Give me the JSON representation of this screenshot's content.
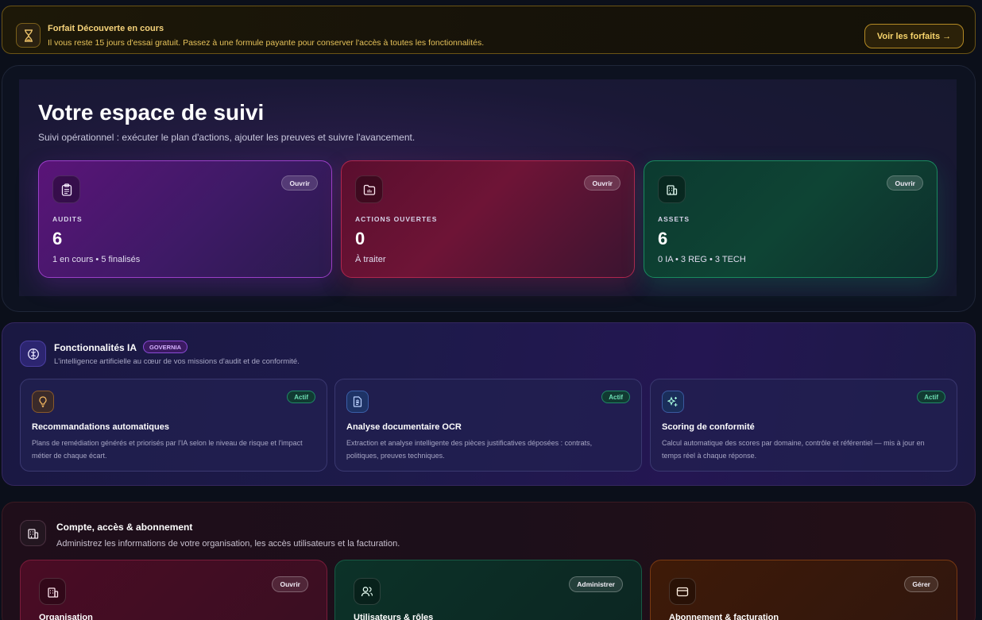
{
  "banner": {
    "title": "Forfait Découverte en cours",
    "message": "Il vous reste 15 jours d'essai gratuit. Passez à une formule payante pour conserver l'accès à toutes les fonctionnalités.",
    "cta": "Voir les forfaits →",
    "icon": "hourglass-icon"
  },
  "hero": {
    "title": "Votre espace de suivi",
    "subtitle": "Suivi opérationnel : exécuter le plan d'actions, ajouter les preuves et suivre l'avancement.",
    "kpis": [
      {
        "label": "AUDITS",
        "value": "6",
        "sub": "1 en cours • 5 finalisés",
        "action": "Ouvrir",
        "icon": "clipboard-icon",
        "color": "#9b3fc8"
      },
      {
        "label": "ACTIONS OUVERTES",
        "value": "0",
        "sub": "À traiter",
        "action": "Ouvrir",
        "icon": "folder-icon",
        "color": "#b0264e"
      },
      {
        "label": "ASSETS",
        "value": "6",
        "sub": "0 IA • 3 REG • 3 TECH",
        "action": "Ouvrir",
        "icon": "building-icon",
        "color": "#198a5e"
      }
    ]
  },
  "ia": {
    "title": "Fonctionnalités IA",
    "badge": "GOVERNIA",
    "description": "L'intelligence artificielle au cœur de vos missions d'audit et de conformité.",
    "features": [
      {
        "title": "Recommandations automatiques",
        "description": "Plans de remédiation générés et priorisés par l'IA selon le niveau de risque et l'impact métier de chaque écart.",
        "status": "Actif",
        "icon": "lightbulb-icon"
      },
      {
        "title": "Analyse documentaire OCR",
        "description": "Extraction et analyse intelligente des pièces justificatives déposées : contrats, politiques, preuves techniques.",
        "status": "Actif",
        "icon": "document-icon"
      },
      {
        "title": "Scoring de conformité",
        "description": "Calcul automatique des scores par domaine, contrôle et référentiel — mis à jour en temps réel à chaque réponse.",
        "status": "Actif",
        "icon": "sparkles-icon"
      }
    ]
  },
  "account": {
    "title": "Compte, accès & abonnement",
    "description": "Administrez les informations de votre organisation, les accès utilisateurs et la facturation.",
    "cards": [
      {
        "title": "Organisation",
        "action": "Ouvrir",
        "icon": "building-icon"
      },
      {
        "title": "Utilisateurs & rôles",
        "action": "Administrer",
        "icon": "users-icon"
      },
      {
        "title": "Abonnement & facturation",
        "action": "Gérer",
        "icon": "credit-card-icon"
      }
    ]
  }
}
